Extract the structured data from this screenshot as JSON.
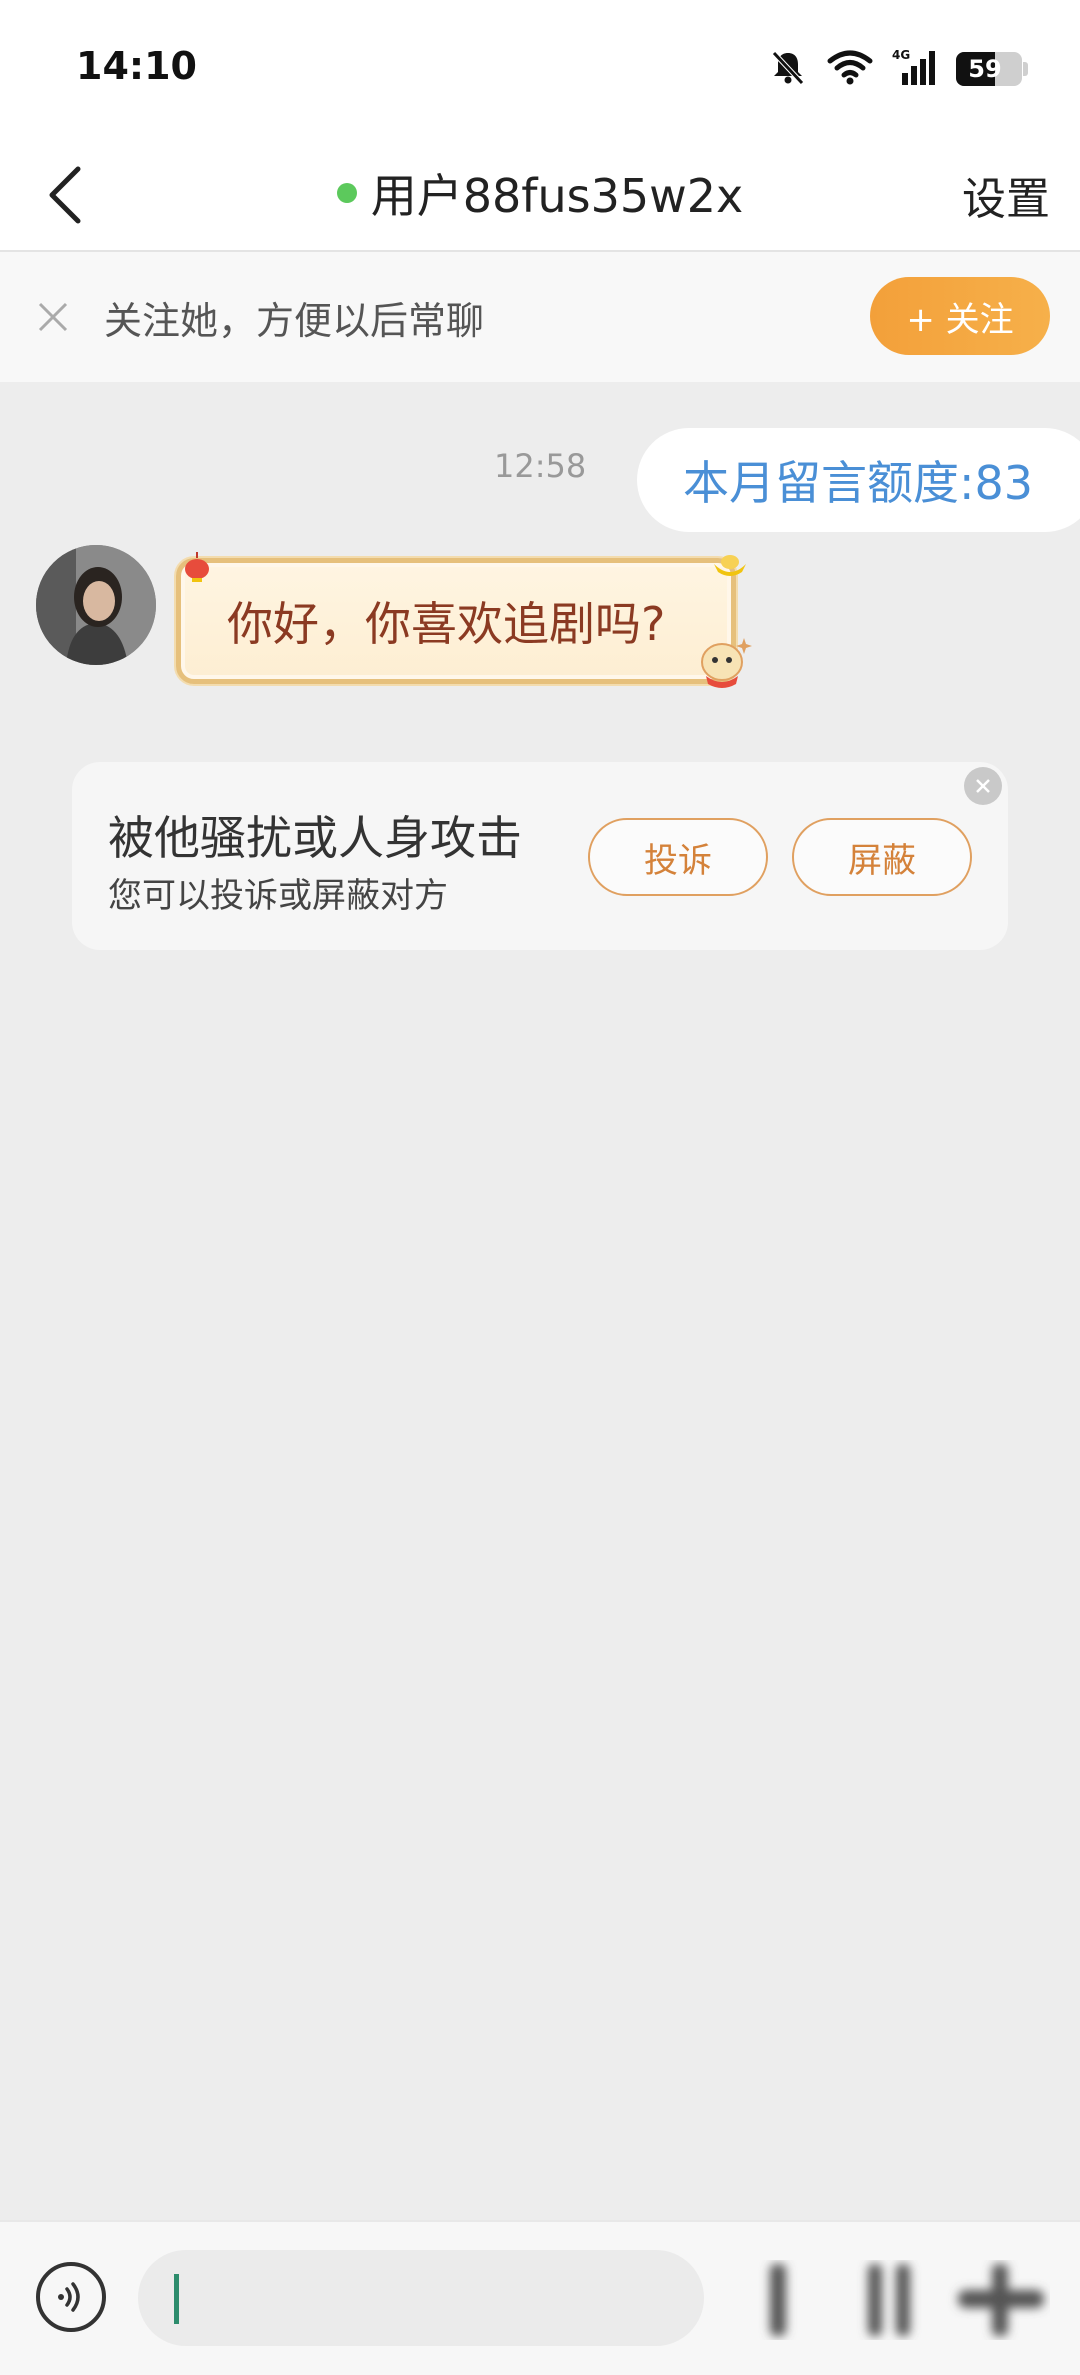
{
  "status_bar": {
    "time": "14:10",
    "battery_level": "59",
    "battery_fraction": 0.59
  },
  "header": {
    "title": "用户88fus35w2x",
    "settings_label": "设置",
    "online_color": "#5cc95c"
  },
  "follow_bar": {
    "text": "关注她，方便以后常聊",
    "button_label": "+ 关注"
  },
  "messages": [
    {
      "side": "right",
      "time": "12:58",
      "text": "本月留言额度:83"
    },
    {
      "side": "left",
      "text": "你好，你喜欢追剧吗?"
    }
  ],
  "safety_card": {
    "title": "被他骚扰或人身攻击",
    "subtitle": "您可以投诉或屏蔽对方",
    "report_label": "投诉",
    "block_label": "屏蔽"
  },
  "colors": {
    "accent": "#f3a03a",
    "link_blue": "#4a8fd6",
    "caret": "#2d8c6c"
  }
}
